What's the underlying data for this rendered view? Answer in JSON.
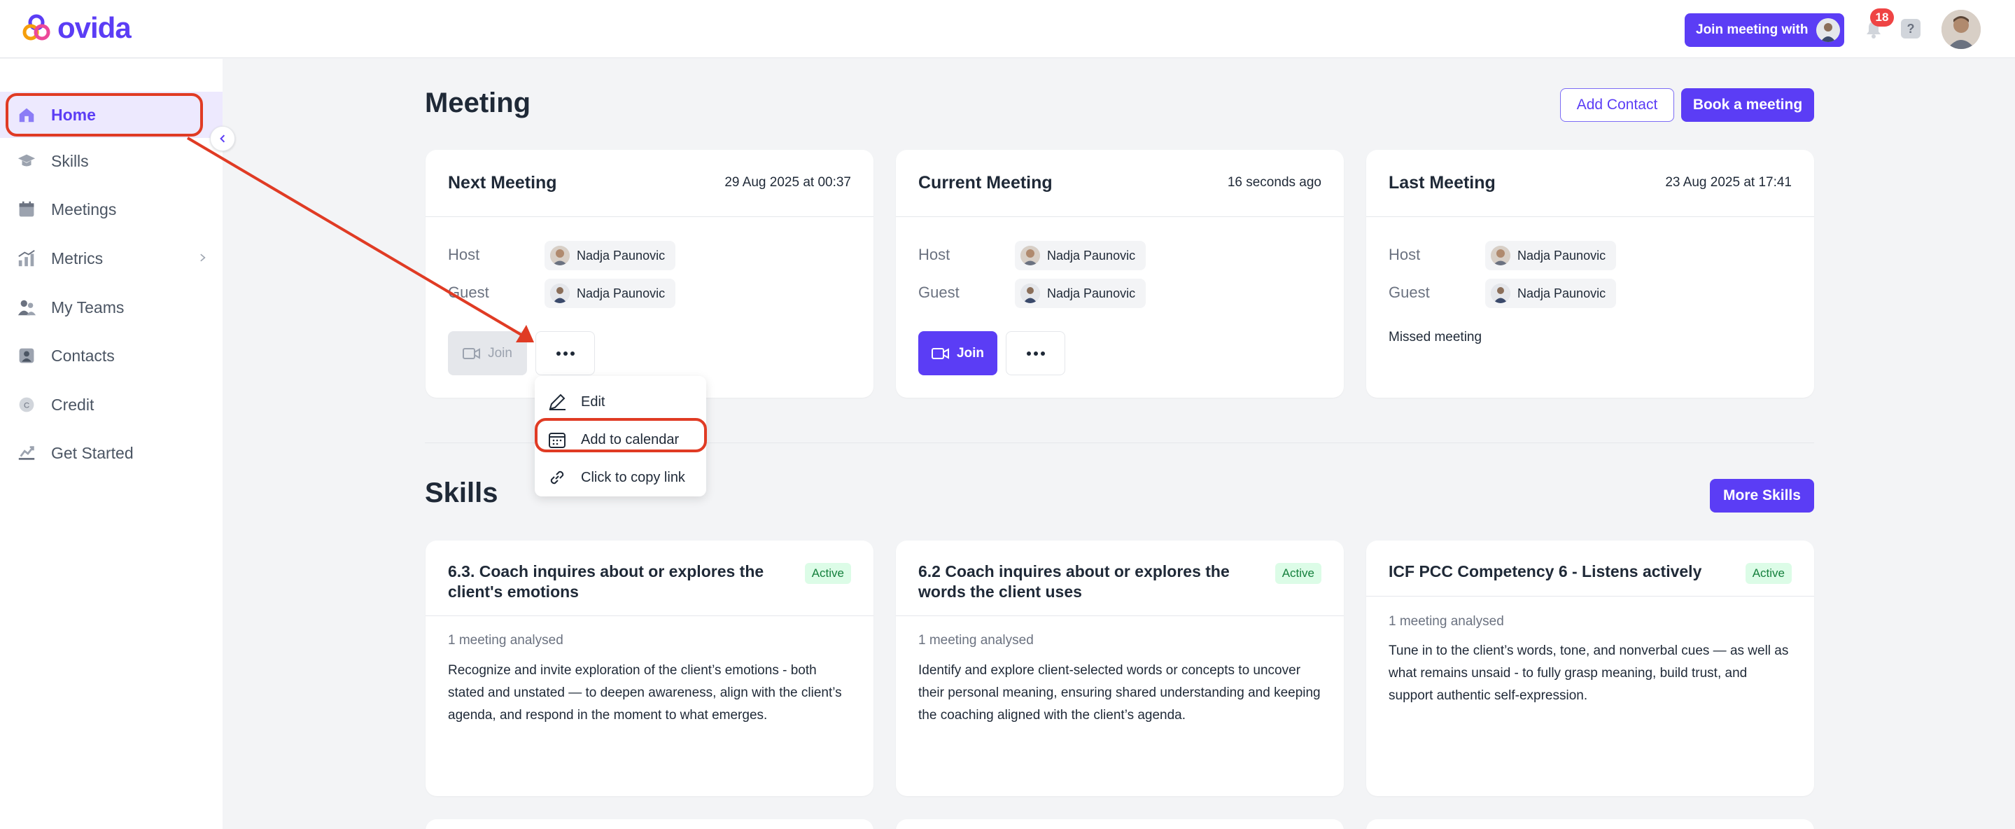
{
  "app": {
    "name": "ovida",
    "brand_color": "#5b3df5"
  },
  "header": {
    "join_meeting_label": "Join meeting with",
    "notification_count": "18",
    "help_label": "?"
  },
  "sidebar": {
    "items": [
      {
        "label": "Home",
        "icon": "home-icon",
        "active": true
      },
      {
        "label": "Skills",
        "icon": "graduation-cap-icon"
      },
      {
        "label": "Meetings",
        "icon": "calendar-icon"
      },
      {
        "label": "Metrics",
        "icon": "chart-icon",
        "has_submenu": true
      },
      {
        "label": "My Teams",
        "icon": "team-icon"
      },
      {
        "label": "Contacts",
        "icon": "contact-icon"
      },
      {
        "label": "Credit",
        "icon": "credit-icon"
      },
      {
        "label": "Get Started",
        "icon": "rocket-icon"
      }
    ]
  },
  "meeting_section": {
    "title": "Meeting",
    "add_contact_label": "Add Contact",
    "book_meeting_label": "Book a meeting",
    "cards": [
      {
        "title": "Next Meeting",
        "date": "29 Aug 2025 at 00:37",
        "host_label": "Host",
        "host_name": "Nadja Paunovic",
        "guest_label": "Guest",
        "guest_name": "Nadja Paunovic",
        "join_label": "Join"
      },
      {
        "title": "Current Meeting",
        "date": "16 seconds ago",
        "host_label": "Host",
        "host_name": "Nadja Paunovic",
        "guest_label": "Guest",
        "guest_name": "Nadja Paunovic",
        "join_label": "Join"
      },
      {
        "title": "Last Meeting",
        "date": "23 Aug 2025 at 17:41",
        "host_label": "Host",
        "host_name": "Nadja Paunovic",
        "guest_label": "Guest",
        "guest_name": "Nadja Paunovic",
        "status": "Missed meeting"
      }
    ]
  },
  "context_menu": {
    "items": [
      {
        "label": "Edit",
        "icon": "pencil-icon"
      },
      {
        "label": "Add to calendar",
        "icon": "calendar-icon"
      },
      {
        "label": "Click to copy link",
        "icon": "link-icon"
      }
    ]
  },
  "skills_section": {
    "title": "Skills",
    "more_label": "More Skills",
    "cards": [
      {
        "title": "6.3. Coach inquires about or explores the client's emotions",
        "badge": "Active",
        "meta": "1 meeting analysed",
        "description": "Recognize and invite exploration of the client’s emotions - both stated and unstated — to deepen awareness, align with the client’s agenda, and respond in the moment to what emerges."
      },
      {
        "title": "6.2 Coach inquires about or explores the words the client uses",
        "badge": "Active",
        "meta": "1 meeting analysed",
        "description": "Identify and explore client-selected words or concepts to uncover their personal meaning, ensuring shared understanding and keeping the coaching aligned with the client’s agenda."
      },
      {
        "title": "ICF PCC Competency 6 - Listens actively",
        "badge": "Active",
        "meta": "1 meeting analysed",
        "description": "Tune in to the client’s words, tone, and nonverbal cues — as well as what remains unsaid - to fully grasp meaning, build trust, and support authentic self-expression."
      }
    ]
  },
  "annotation_color": "#e03b24"
}
